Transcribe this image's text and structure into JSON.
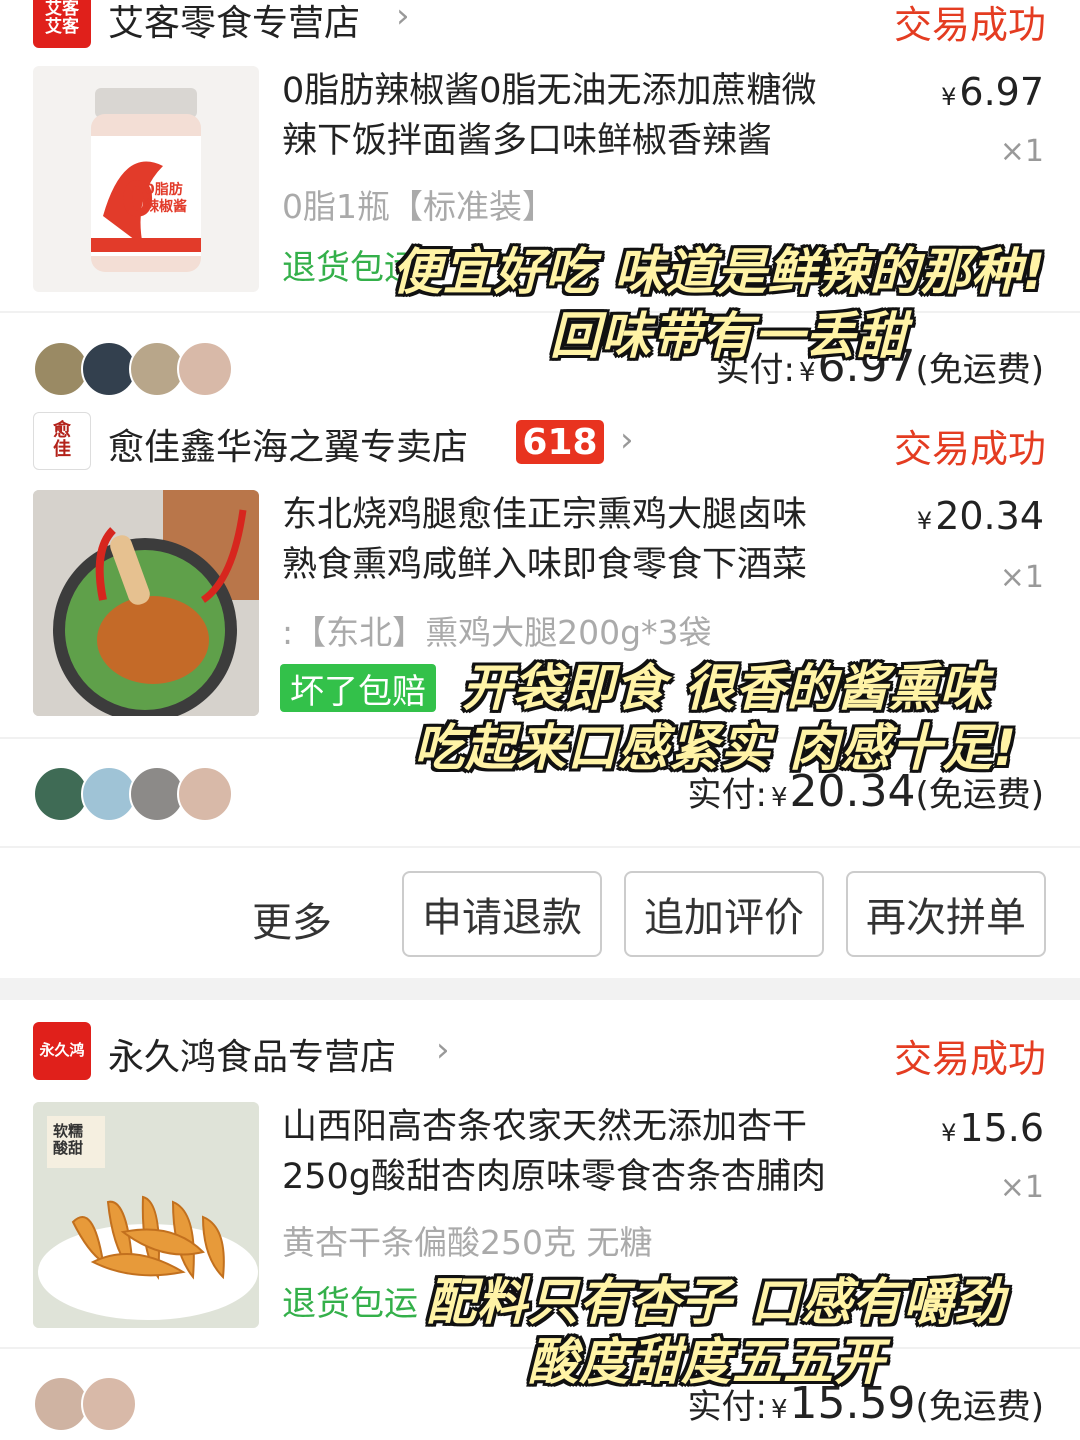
{
  "orders": [
    {
      "shop": {
        "logo": "艾客\n艾客",
        "name": "艾客零食专营店",
        "status": "交易成功"
      },
      "item": {
        "title_line1": "0脂肪辣椒酱0脂无油无添加蔗糖微",
        "title_line2": "辣下饭拌面酱多口味鲜椒香辣酱",
        "price": "6.97",
        "yen": "¥",
        "qty": "×1",
        "spec": "0脂1瓶【标准装】",
        "service": "退货包运",
        "thumb_label": "0脂肪\n辣椒酱"
      },
      "paid": {
        "label": "实付:",
        "yen": "¥",
        "amount": "6.97",
        "fee": "(免运费)"
      }
    },
    {
      "shop": {
        "logo": "愈\n佳",
        "name": "愈佳鑫华海之翼专卖店",
        "badge": "618",
        "status": "交易成功"
      },
      "item": {
        "title_line1": "东北烧鸡腿愈佳正宗熏鸡大腿卤味",
        "title_line2": "熟食熏鸡咸鲜入味即食零食下酒菜",
        "price": "20.34",
        "yen": "¥",
        "qty": "×1",
        "spec": ":【东北】熏鸡大腿200g*3袋",
        "service_badge": "坏了包赔"
      },
      "paid": {
        "label": "实付:",
        "yen": "¥",
        "amount": "20.34",
        "fee": "(免运费)"
      }
    },
    {
      "shop": {
        "logo": "永久鸿",
        "name": "永久鸿食品专营店",
        "status": "交易成功"
      },
      "item": {
        "title_line1": "山西阳高杏条农家天然无添加杏干",
        "title_line2": "250g酸甜杏肉原味零食杏条杏脯肉",
        "price": "15.6",
        "yen": "¥",
        "qty": "×1",
        "spec": "黄杏干条偏酸250克  无糖",
        "service": "退货包运",
        "thumb_label": "软糯\n酸甜"
      },
      "paid": {
        "label": "实付:",
        "yen": "¥",
        "amount": "15.59",
        "fee": "(免运费)"
      }
    }
  ],
  "actions": {
    "more": "更多",
    "refund": "申请退款",
    "review": "追加评价",
    "reorder": "再次拼单"
  },
  "overlays": {
    "o1_line1": "便宜好吃 味道是鲜辣的那种!",
    "o1_line2": "回味带有一丢甜",
    "o2_line1": "开袋即食 很香的酱熏味",
    "o2_line2": "吃起来口感紧实 肉感十足!",
    "o3_line1": "配料只有杏子 口感有嚼劲",
    "o3_line2": "酸度甜度五五开"
  },
  "colors": {
    "status": "#e43c21",
    "service": "#34b04a",
    "badge618": "#e8331f",
    "overlay_text": "#fff3a6"
  }
}
